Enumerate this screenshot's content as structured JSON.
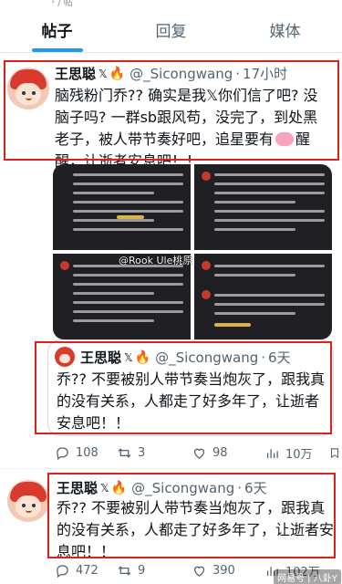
{
  "top_strip": "¹ / 帖",
  "tabs": [
    {
      "label": "帖子",
      "active": true
    },
    {
      "label": "回复",
      "active": false
    },
    {
      "label": "媒体",
      "active": false
    }
  ],
  "post1": {
    "name": "王思聪",
    "badge": "𝕏",
    "fire": "🔥",
    "handle": "@_Sicongwang",
    "time": "17小时",
    "text_before_icon": "脑残粉门乔?? 确实是我𝕏你们信了吧? 没脑子吗? 一群sb跟风苟，没完了，到处黑老子，被人带节奏好吧，追星要有",
    "text_after_icon": "醒醒，让逝者安息吧！！",
    "image_watermark": "@Rook Ule桃原"
  },
  "quoted": {
    "name": "王思聪",
    "badge": "𝕏",
    "fire": "🔥",
    "handle": "@_Sicongwang",
    "time": "6天",
    "text": "乔?? 不要被别人带节奏当炮灰了，跟我真的没有关系，人都走了好多年了，让逝者安息吧！！"
  },
  "post1_actions": {
    "reply": "108",
    "retweet": "3",
    "like": "98",
    "views": "10万"
  },
  "post2": {
    "name": "王思聪",
    "badge": "𝕏",
    "fire": "🔥",
    "handle": "@_Sicongwang",
    "time": "6天",
    "text": "乔?? 不要被别人带节奏当炮灰了，跟我真的没有关系，人都走了好多年了，让逝者安息吧！！"
  },
  "post2_actions": {
    "reply": "472",
    "retweet": "9",
    "like": "390",
    "views": "102万"
  },
  "footer_watermark": "网易号 | 八卦Y",
  "colors": {
    "highlight_box": "#e0201b",
    "accent": "#1d9bf0",
    "muted": "#536471"
  }
}
